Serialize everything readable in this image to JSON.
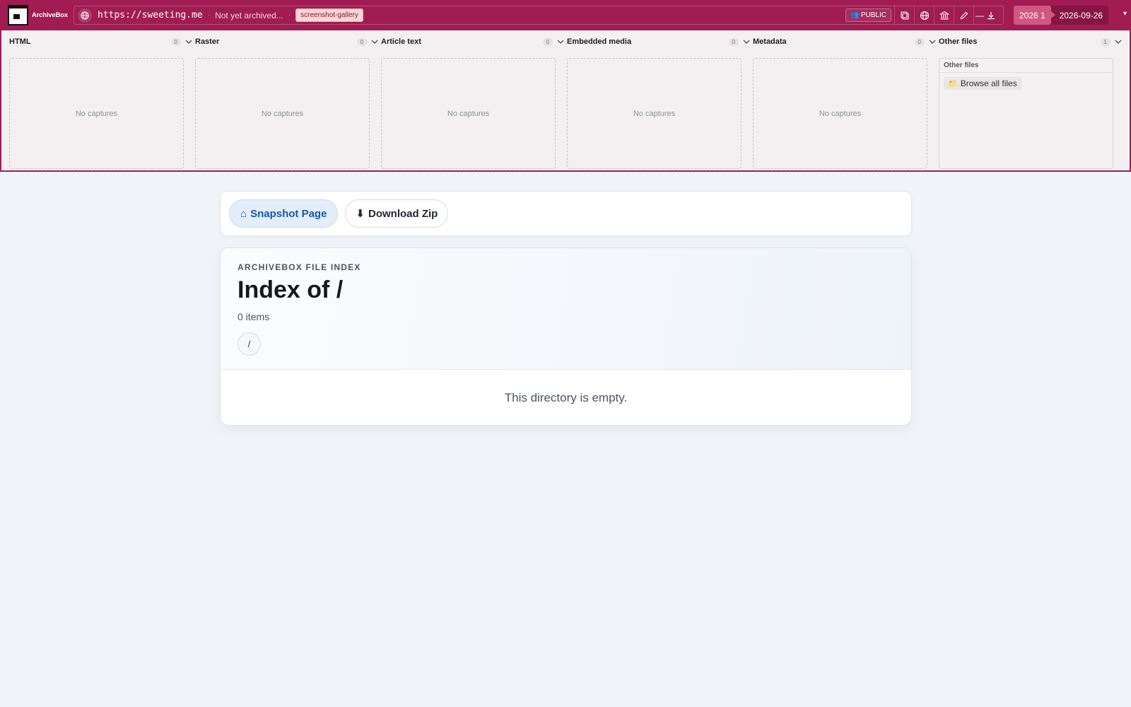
{
  "app": {
    "name": "ArchiveBox"
  },
  "topbar": {
    "url": "https://sweeting.me",
    "status": "Not yet archived...",
    "tag": "screenshot-gallery",
    "visibility": "PUBLIC",
    "separator": "·",
    "timeline": {
      "year": "2026 1",
      "date": "2026-09-26"
    }
  },
  "panels": [
    {
      "title": "HTML",
      "count": "0",
      "empty": "No captures"
    },
    {
      "title": "Raster",
      "count": "0",
      "empty": "No captures"
    },
    {
      "title": "Article text",
      "count": "0",
      "empty": "No captures"
    },
    {
      "title": "Embedded media",
      "count": "0",
      "empty": "No captures"
    },
    {
      "title": "Metadata",
      "count": "0",
      "empty": "No captures"
    }
  ],
  "other_files": {
    "title": "Other files",
    "count": "1",
    "header": "Other files",
    "browse_label": "Browse all files"
  },
  "toolbar": {
    "snapshot_label": "Snapshot Page",
    "snapshot_icon": "⌂",
    "download_label": "Download Zip",
    "download_icon": "⬇"
  },
  "index": {
    "eyebrow": "ARCHIVEBOX FILE INDEX",
    "title": "Index of /",
    "item_count": "0 items",
    "crumb": "/",
    "empty_message": "This directory is empty."
  },
  "colors": {
    "accent": "#a01c52",
    "primary_text": "#1857a8"
  }
}
